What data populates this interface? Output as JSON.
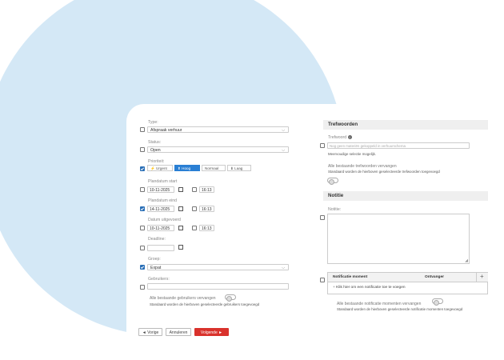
{
  "form": {
    "type": {
      "label": "Type:",
      "value": "Afspraak verhuur"
    },
    "status": {
      "label": "Status:",
      "value": "Open"
    },
    "priority": {
      "label": "Prioriteit:",
      "options": [
        "Urgent",
        "Hoog",
        "Normaal",
        "Laag"
      ],
      "selected": "Hoog"
    },
    "plan_start": {
      "label": "Plandatum start",
      "date": "10-11-2025",
      "time": "16:13"
    },
    "plan_end": {
      "label": "Plandatum eind",
      "date": "14-11-2025",
      "time": "16:13"
    },
    "exec_date": {
      "label": "Datum uitgevoerd",
      "date": "10-11-2025",
      "time": "16:13"
    },
    "deadline": {
      "label": "Deadline:",
      "value": ""
    },
    "group": {
      "label": "Groep:",
      "value": "Expat"
    },
    "users": {
      "label": "Gebruikers:",
      "value": ""
    },
    "replace_users": {
      "label": "Alle bestaande gebruikers vervangen",
      "hint": "Standaard worden de hierboven geselecteerde gebruikers toegevoegd"
    }
  },
  "keywords": {
    "title": "Trefwoorden",
    "field_label": "Trefwoord",
    "placeholder": "Nog geen materiën gekoppeld in verhuurschema",
    "hint": "Meervoudige selectie mogelijk.",
    "replace_label": "Alle bestaande trefwoorden vervangen",
    "replace_hint": "Standaard worden de hierboven geselecteerde trefwoorden toegevoegd"
  },
  "note": {
    "title": "Notitie",
    "field_label": "Notitie:"
  },
  "notifications": {
    "col_moment": "Notificatie moment",
    "col_recipient": "Ontvanger",
    "add_text": "Klik hier om een notificatie toe te voegen",
    "replace_label": "Alle bestaande notificatie momenten vervangen",
    "replace_hint": "Standaard worden de hierboven geselecteerde notificatie momenten toegevoegd"
  },
  "buttons": {
    "prev": "◄ Vorige",
    "cancel": "Annuleren",
    "next": "Volgende ►"
  },
  "colors": {
    "accent": "#2a7fd4",
    "primary_button": "#d9322c",
    "background_circle": "#d4e8f6"
  }
}
